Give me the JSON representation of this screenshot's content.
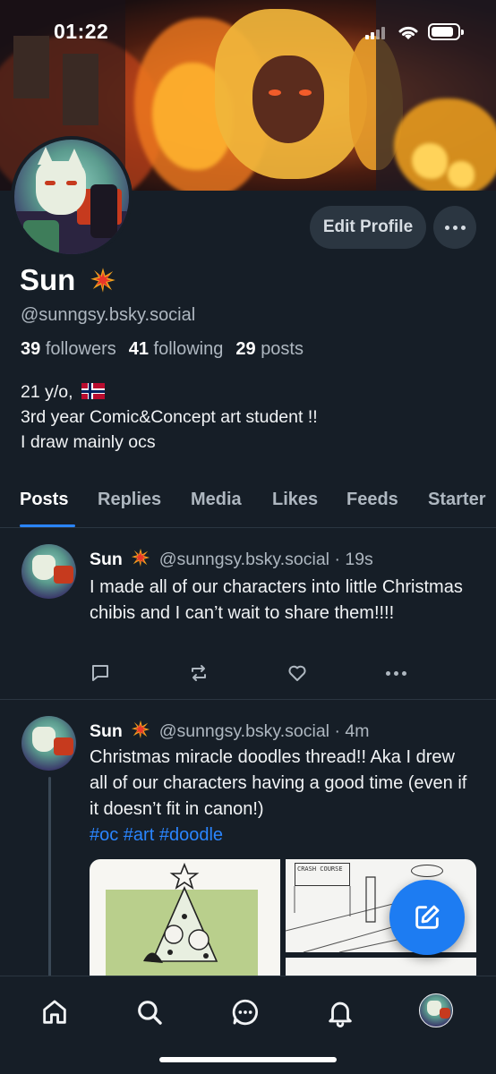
{
  "status_bar": {
    "time": "01:22"
  },
  "profile": {
    "display_name": "Sun",
    "handle": "@sunngsy.bsky.social",
    "edit_label": "Edit Profile",
    "stats": {
      "followers_count": "39",
      "followers_label": "followers",
      "following_count": "41",
      "following_label": "following",
      "posts_count": "29",
      "posts_label": "posts"
    },
    "bio": {
      "line1": "21 y/o,",
      "line2": "3rd year Comic&Concept art student !!",
      "line3": "I draw mainly ocs"
    }
  },
  "tabs": [
    "Posts",
    "Replies",
    "Media",
    "Likes",
    "Feeds",
    "Starter"
  ],
  "active_tab": "Posts",
  "posts": [
    {
      "author": "Sun",
      "handle": "@sunngsy.bsky.social",
      "time": "· 19s",
      "text": "I made all of our characters into little Christmas chibis and I can’t wait to share them!!!!"
    },
    {
      "author": "Sun",
      "handle": "@sunngsy.bsky.social",
      "time": "· 4m",
      "text": "Christmas miracle doodles thread!! Aka I drew all of our characters having a good time (even if it doesn’t fit in canon!)",
      "tags": "#oc #art #doodle",
      "image_text": "CRASH COURSE"
    }
  ],
  "colors": {
    "accent": "#2a85ff",
    "background": "#161e27",
    "muted": "#aeb7c0",
    "button": "#2b3641",
    "fab": "#1d7cf2"
  },
  "icons": [
    "home-icon",
    "search-icon",
    "chat-icon",
    "bell-icon",
    "profile-avatar",
    "compose-icon",
    "reply-icon",
    "repost-icon",
    "like-icon",
    "more-icon"
  ]
}
